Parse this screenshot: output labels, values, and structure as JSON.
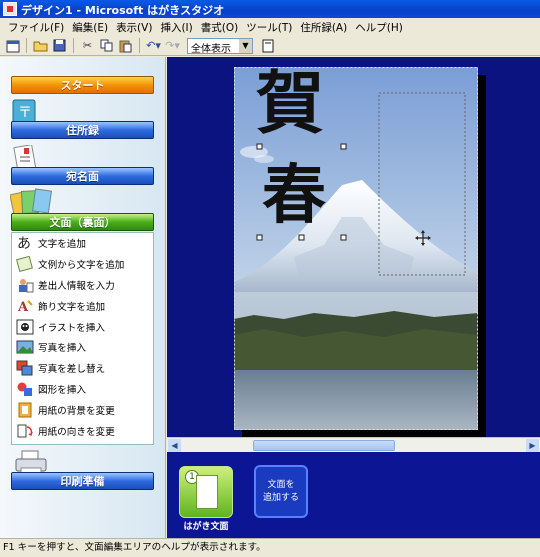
{
  "window": {
    "title": "デザイン1 - Microsoft はがきスタジオ"
  },
  "menu": [
    "ファイル(F)",
    "編集(E)",
    "表示(V)",
    "挿入(I)",
    "書式(O)",
    "ツール(T)",
    "住所録(A)",
    "ヘルプ(H)"
  ],
  "toolbar": {
    "zoom_value": "全体表示",
    "icons": [
      "calendar-icon",
      "open-folder-icon",
      "save-icon",
      "cut-icon",
      "copy-icon",
      "paste-icon",
      "undo-icon",
      "redo-icon",
      "page-view-icon"
    ]
  },
  "sidebar": {
    "start_label": "スタート",
    "address_book_label": "住所録",
    "recipient_label": "宛名面",
    "text_face_label": "文面（裏面）",
    "print_label": "印刷準備",
    "tasks": [
      {
        "label": "文字を追加",
        "icon": "add-text-icon"
      },
      {
        "label": "文例から文字を追加",
        "icon": "template-text-icon"
      },
      {
        "label": "差出人情報を入力",
        "icon": "sender-info-icon"
      },
      {
        "label": "飾り文字を追加",
        "icon": "decorative-text-icon"
      },
      {
        "label": "イラストを挿入",
        "icon": "illustration-icon"
      },
      {
        "label": "写真を挿入",
        "icon": "photo-icon"
      },
      {
        "label": "写真を差し替え",
        "icon": "replace-photo-icon"
      },
      {
        "label": "図形を挿入",
        "icon": "shape-icon"
      },
      {
        "label": "用紙の背景を変更",
        "icon": "background-icon"
      },
      {
        "label": "用紙の向きを変更",
        "icon": "orientation-icon"
      }
    ]
  },
  "canvas": {
    "calligraphy_top": "賀",
    "calligraphy_bottom": "春"
  },
  "pages": {
    "thumb_number": "1",
    "thumb_label": "はがき文面",
    "add_button_label": "文面を\n追加する"
  },
  "status": {
    "text": "F1 キーを押すと、文面編集エリアのヘルプが表示されます。"
  }
}
